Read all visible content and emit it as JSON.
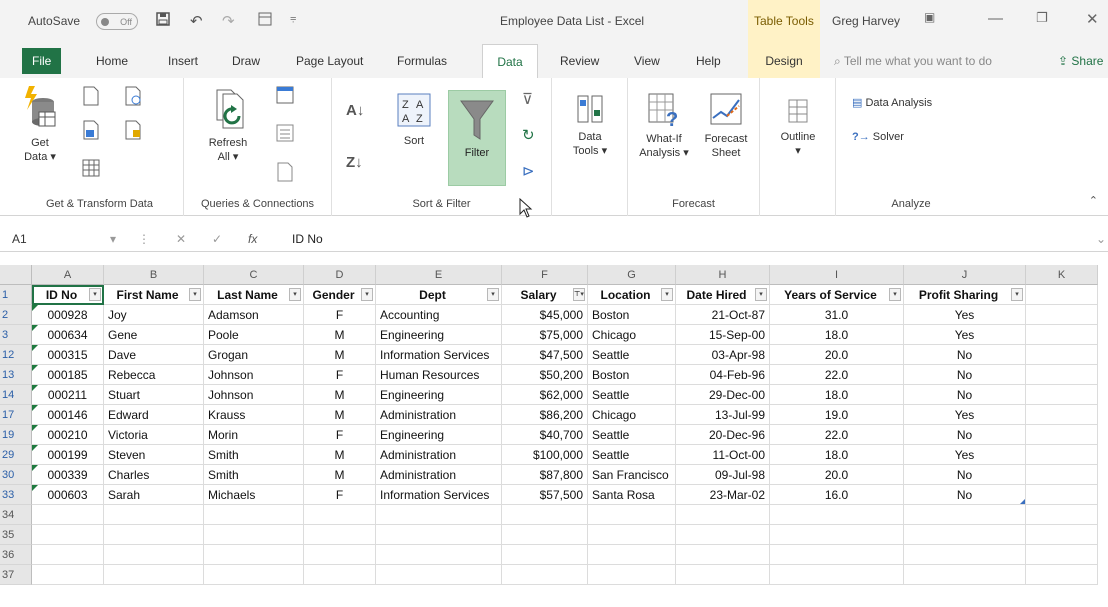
{
  "titlebar": {
    "autosave_label": "AutoSave",
    "autosave_state": "Off",
    "document_title": "Employee Data List - Excel",
    "table_tools_label": "Table Tools",
    "user_name": "Greg Harvey"
  },
  "tabs": [
    {
      "label": "File"
    },
    {
      "label": "Home"
    },
    {
      "label": "Insert"
    },
    {
      "label": "Draw"
    },
    {
      "label": "Page Layout"
    },
    {
      "label": "Formulas"
    },
    {
      "label": "Data",
      "active": true
    },
    {
      "label": "Review"
    },
    {
      "label": "View"
    },
    {
      "label": "Help"
    },
    {
      "label": "Design"
    }
  ],
  "search_placeholder": "Tell me what you want to do",
  "share_label": "Share",
  "ribbon": {
    "get_transform": {
      "get_data": "Get",
      "get_data2": "Data ▾",
      "group": "Get & Transform Data"
    },
    "queries": {
      "refresh": "Refresh",
      "refresh2": "All ▾",
      "group": "Queries & Connections"
    },
    "sort_filter": {
      "sort": "Sort",
      "filter": "Filter",
      "group": "Sort & Filter"
    },
    "data_tools": {
      "label": "Data",
      "label2": "Tools ▾"
    },
    "forecast": {
      "whatif": "What-If",
      "whatif2": "Analysis ▾",
      "sheet": "Forecast",
      "sheet2": "Sheet",
      "group": "Forecast"
    },
    "outline": {
      "label": "Outline",
      "label2": "▾"
    },
    "analyze": {
      "data_analysis": "Data Analysis",
      "solver": "Solver",
      "group": "Analyze"
    }
  },
  "formula_bar": {
    "name_box": "A1",
    "content": "ID No"
  },
  "columns": [
    "A",
    "B",
    "C",
    "D",
    "E",
    "F",
    "G",
    "H",
    "I",
    "J",
    "K"
  ],
  "header_row": {
    "row_number": "1",
    "cells": [
      "ID No",
      "First Name",
      "Last Name",
      "Gender",
      "Dept",
      "Salary",
      "Location",
      "Date Hired",
      "Years of Service",
      "Profit Sharing"
    ]
  },
  "rows": [
    {
      "row_number": "2",
      "cells": [
        "000928",
        "Joy",
        "Adamson",
        "F",
        "Accounting",
        "$45,000",
        "Boston",
        "21-Oct-87",
        "31.0",
        "Yes"
      ]
    },
    {
      "row_number": "3",
      "cells": [
        "000634",
        "Gene",
        "Poole",
        "M",
        "Engineering",
        "$75,000",
        "Chicago",
        "15-Sep-00",
        "18.0",
        "Yes"
      ]
    },
    {
      "row_number": "12",
      "cells": [
        "000315",
        "Dave",
        "Grogan",
        "M",
        "Information Services",
        "$47,500",
        "Seattle",
        "03-Apr-98",
        "20.0",
        "No"
      ]
    },
    {
      "row_number": "13",
      "cells": [
        "000185",
        "Rebecca",
        "Johnson",
        "F",
        "Human Resources",
        "$50,200",
        "Boston",
        "04-Feb-96",
        "22.0",
        "No"
      ]
    },
    {
      "row_number": "14",
      "cells": [
        "000211",
        "Stuart",
        "Johnson",
        "M",
        "Engineering",
        "$62,000",
        "Seattle",
        "29-Dec-00",
        "18.0",
        "No"
      ]
    },
    {
      "row_number": "17",
      "cells": [
        "000146",
        "Edward",
        "Krauss",
        "M",
        "Administration",
        "$86,200",
        "Chicago",
        "13-Jul-99",
        "19.0",
        "Yes"
      ]
    },
    {
      "row_number": "19",
      "cells": [
        "000210",
        "Victoria",
        "Morin",
        "F",
        "Engineering",
        "$40,700",
        "Seattle",
        "20-Dec-96",
        "22.0",
        "No"
      ]
    },
    {
      "row_number": "29",
      "cells": [
        "000199",
        "Steven",
        "Smith",
        "M",
        "Administration",
        "$100,000",
        "Seattle",
        "11-Oct-00",
        "18.0",
        "Yes"
      ]
    },
    {
      "row_number": "30",
      "cells": [
        "000339",
        "Charles",
        "Smith",
        "M",
        "Administration",
        "$87,800",
        "San Francisco",
        "09-Jul-98",
        "20.0",
        "No"
      ]
    },
    {
      "row_number": "33",
      "cells": [
        "000603",
        "Sarah",
        "Michaels",
        "F",
        "Information Services",
        "$57,500",
        "Santa Rosa",
        "23-Mar-02",
        "16.0",
        "No"
      ]
    }
  ],
  "empty_rows": [
    "34",
    "35",
    "36",
    "37"
  ],
  "colors": {
    "accent": "#217346",
    "filter_active": "#b8dcbe",
    "filtered_row_number": "#2b5fa8"
  }
}
